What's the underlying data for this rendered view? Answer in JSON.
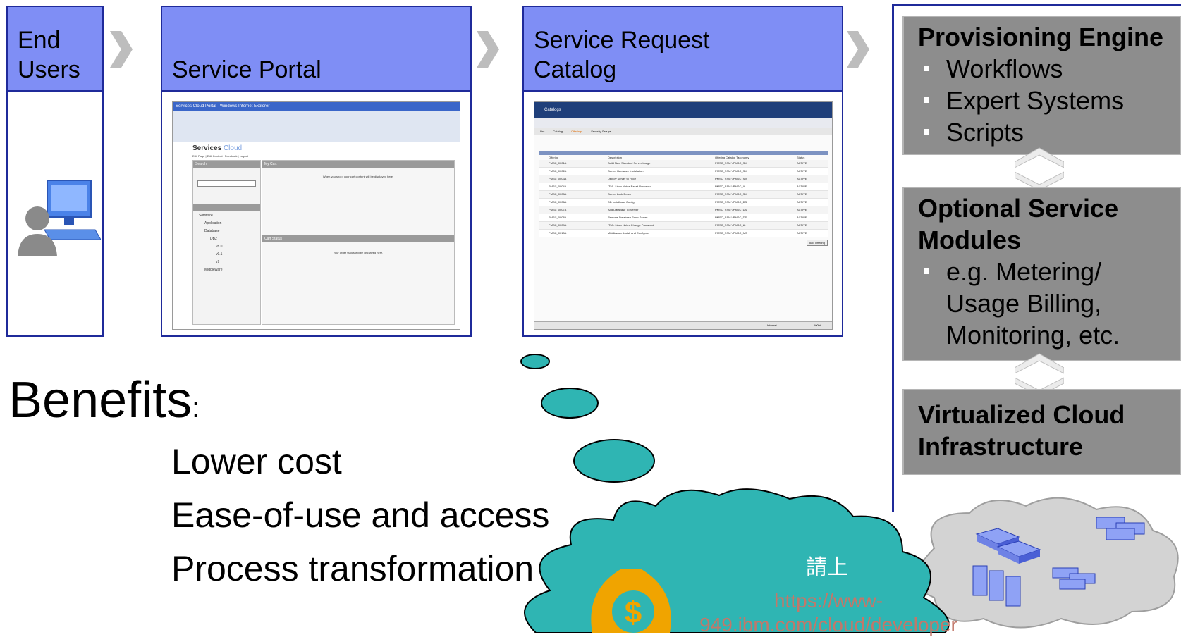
{
  "stages": [
    {
      "title": "End\nUsers"
    },
    {
      "title": "Service Portal"
    },
    {
      "title": "Service Request\nCatalog"
    }
  ],
  "portal_screenshot": {
    "window_title": "Services Cloud Portal - Windows Internet Explorer",
    "brand": "Services",
    "brand_suffix": "Cloud",
    "links": "Edit Page | Edit Content | Feedback | Logout",
    "search_panel": "Search",
    "cart_panel": "My Cart",
    "cart_msg": "When you shop, your cart content will be displayed here.",
    "status_panel": "Cart Status",
    "status_msg": "Your order status will be displayed here.",
    "tree": [
      "Software",
      "Application",
      "Database",
      "DB2",
      "v8.0",
      "v9.1",
      "v9",
      "Middleware"
    ]
  },
  "catalog_screenshot": {
    "title": "Catalogs",
    "tabs": [
      "List",
      "Catalog",
      "Offerings",
      "Security Groups"
    ],
    "columns": [
      "Offering",
      "Description",
      "Offering Catalog Taxonomy",
      "Status"
    ],
    "rows": [
      [
        "PMSC_0001A",
        "Build New Standard Server Image",
        "PMSC_SSM \\ PMSC_SM",
        "ACTIVE"
      ],
      [
        "PMSC_0002A",
        "Server Hardware Installation",
        "PMSC_SSM \\ PMSC_SM",
        "ACTIVE"
      ],
      [
        "PMSC_0003A",
        "Deploy Server to Floor",
        "PMSC_SSM \\ PMSC_SM",
        "ACTIVE"
      ],
      [
        "PMSC_0004A",
        "ITM - Linux Notes Reset Password",
        "PMSC_SSM \\ PMSC_IA",
        "ACTIVE"
      ],
      [
        "PMSC_0005A",
        "Server Lock Down",
        "PMSC_SSM \\ PMSC_SM",
        "ACTIVE"
      ],
      [
        "PMSC_0006A",
        "DB Install and Config",
        "PMSC_SSM \\ PMSC_DS",
        "ACTIVE"
      ],
      [
        "PMSC_0007A",
        "Add Database To Server",
        "PMSC_SSM \\ PMSC_DS",
        "ACTIVE"
      ],
      [
        "PMSC_0008A",
        "Remove Database From Server",
        "PMSC_SSM \\ PMSC_DS",
        "ACTIVE"
      ],
      [
        "PMSC_0009A",
        "ITM - Linux Notes Change Password",
        "PMSC_SSM \\ PMSC_IA",
        "ACTIVE"
      ],
      [
        "PMSC_0010A",
        "Middleware Install and Configure",
        "PMSC_SSM \\ PMSC_MS",
        "ACTIVE"
      ]
    ],
    "button": "Add Offering",
    "status_left": "Internet",
    "zoom": "100%"
  },
  "provisioning": {
    "title": "Provisioning Engine",
    "items": [
      "Workflows",
      "Expert Systems",
      "Scripts"
    ]
  },
  "optional": {
    "title_line1": "Optional Service",
    "title_line2": "Modules",
    "items": [
      "e.g. Metering/",
      "Usage Billing,",
      "Monitoring, etc."
    ]
  },
  "infrastructure": {
    "title_line1": "Virtualized Cloud",
    "title_line2": "Infrastructure"
  },
  "benefits": {
    "heading": "Benefits",
    "colon": ":",
    "items": [
      "Lower cost",
      "Ease-of-use and access",
      "Process transformation"
    ]
  },
  "callout": {
    "text": "請上",
    "link_line1": "https://www-",
    "link_line2": "949.ibm.com/cloud/developer"
  },
  "colors": {
    "header_blue": "#7f8ef5",
    "border_blue": "#1f2a9a",
    "box_gray": "#8d8d8d",
    "teal": "#2fb5b3",
    "dollar": "#f0a400"
  }
}
